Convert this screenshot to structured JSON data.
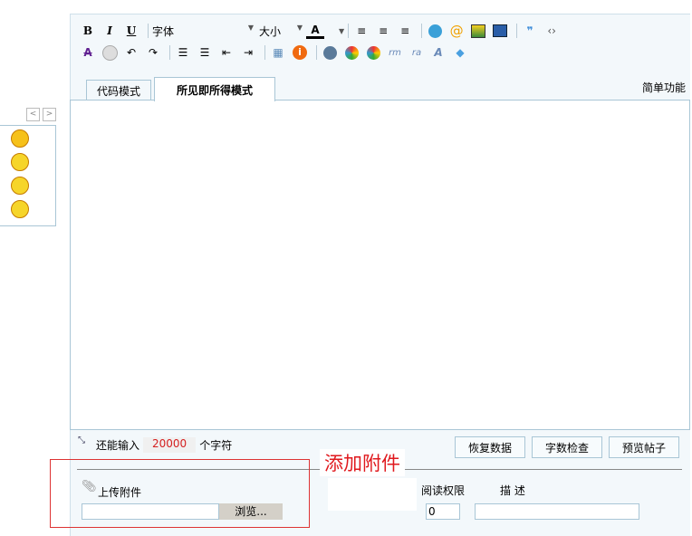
{
  "toolbar": {
    "font_label": "字体",
    "size_label": "大小",
    "row1": [
      "bold-icon",
      "italic-icon",
      "underline-icon",
      "font-color-icon",
      "align-left-icon",
      "align-center-icon",
      "align-right-icon",
      "emoticon-icon",
      "at-icon",
      "image-icon",
      "media-icon",
      "quote-icon",
      "code-icon"
    ],
    "row2": [
      "remove-format-icon",
      "smiley-icon",
      "undo-icon",
      "redo-icon",
      "ordered-list-icon",
      "unordered-list-icon",
      "outdent-icon",
      "indent-icon",
      "table-icon",
      "info-icon",
      "flash-icon",
      "wmv-icon",
      "wma-icon",
      "rm-icon",
      "ra-icon",
      "font-icon",
      "cloud-icon"
    ]
  },
  "tabs": [
    {
      "label": "代码模式"
    },
    {
      "label": "所见即所得模式"
    }
  ],
  "simple_mode": "简单功能",
  "status": {
    "prefix": "还能输入",
    "count": "20000",
    "suffix": "个字符"
  },
  "buttons": {
    "restore": "恢复数据",
    "check": "字数检查",
    "preview": "预览帖子"
  },
  "annotation": "添加附件",
  "attachment": {
    "label": "上传附件",
    "browse": "浏览...",
    "read_perm_label": "阅读权限",
    "read_perm_value": "0",
    "desc_label": "描 述",
    "file_value": "",
    "desc_value": ""
  },
  "colors": {
    "annotation": "#e0191e",
    "count": "#d42020",
    "border": "#a9c6d6"
  }
}
